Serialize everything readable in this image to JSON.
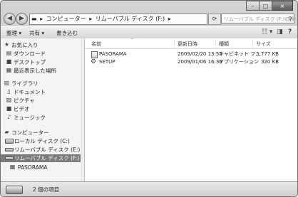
{
  "titlebar": {
    "minimize": "–",
    "maximize": "□",
    "close": "×"
  },
  "navbar": {
    "back": "◀",
    "forward": "▶",
    "path": [
      "コンピューター",
      "リムーバブル ディスク (F:)"
    ],
    "path_sep": "▸",
    "refresh": "⟳",
    "search_placeholder": "リムーバブル ディスク (F:)の検索"
  },
  "toolbar": {
    "organize": "整理 ▾",
    "share": "共有 ▾",
    "burn": "書き込む",
    "views": "☷ ▾",
    "preview": "◨",
    "help": "?"
  },
  "nav": {
    "favorites": "お気に入り",
    "downloads": "ダウンロード",
    "desktop": "デスクトップ",
    "recent": "最近表示した場所",
    "libraries": "ライブラリ",
    "documents": "ドキュメント",
    "pictures": "ピクチャ",
    "videos": "ビデオ",
    "music": "ミュージック",
    "computer": "コンピューター",
    "local_disk": "ローカル ディスク (C:)",
    "removable_e": "リムーバブル ディスク (E:)",
    "removable_f": "リムーバブル ディスク (F:)",
    "pasorama": "PASORAMA"
  },
  "columns": {
    "name": "名前",
    "date": "更新日時",
    "type": "種類",
    "size": "サイズ"
  },
  "files": [
    {
      "name": "PASORAMA",
      "date": "2009/02/20 13:55",
      "type": "キャビネット フ...",
      "size": "5,777 KB"
    },
    {
      "name": "SETUP",
      "date": "2009/01/06 16:36",
      "type": "アプリケーション",
      "size": "320 KB"
    }
  ],
  "status": {
    "count": "2 個の項目"
  }
}
